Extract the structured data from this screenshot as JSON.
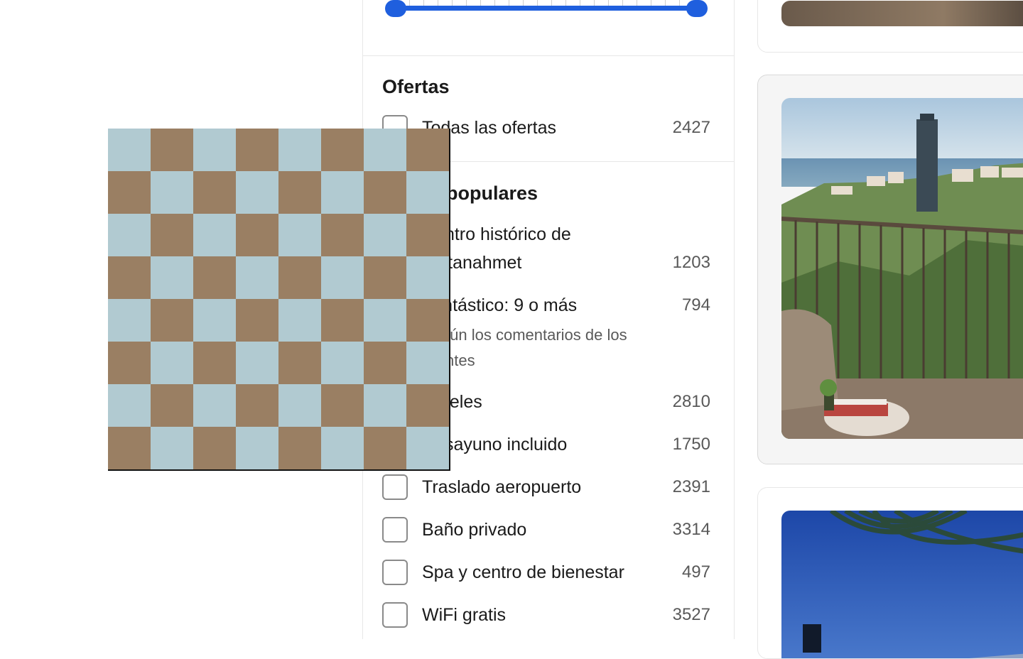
{
  "filters": {
    "deals": {
      "title": "Ofertas",
      "items": [
        {
          "label": "Todas las ofertas",
          "count": "2427"
        }
      ]
    },
    "popular": {
      "title": "Filtros populares",
      "items": [
        {
          "label": "Centro histórico de Sultanahmet",
          "count": "1203"
        },
        {
          "label": "Fantástico: 9 o más",
          "sub": "Según los comentarios de los clientes",
          "count": "794"
        },
        {
          "label": "Hoteles",
          "count": "2810"
        },
        {
          "label": "Desayuno incluido",
          "count": "1750"
        },
        {
          "label": "Traslado aeropuerto",
          "count": "2391"
        },
        {
          "label": "Baño privado",
          "count": "3314"
        },
        {
          "label": "Spa y centro de bienestar",
          "count": "497"
        },
        {
          "label": "WiFi gratis",
          "count": "3527"
        }
      ]
    }
  },
  "colors": {
    "accent": "#1f5fde",
    "checker_light": "#b1cad1",
    "checker_dark": "#9a7f63"
  },
  "icons": {
    "checkbox": "checkbox-icon",
    "slider_handle": "slider-handle-icon"
  }
}
